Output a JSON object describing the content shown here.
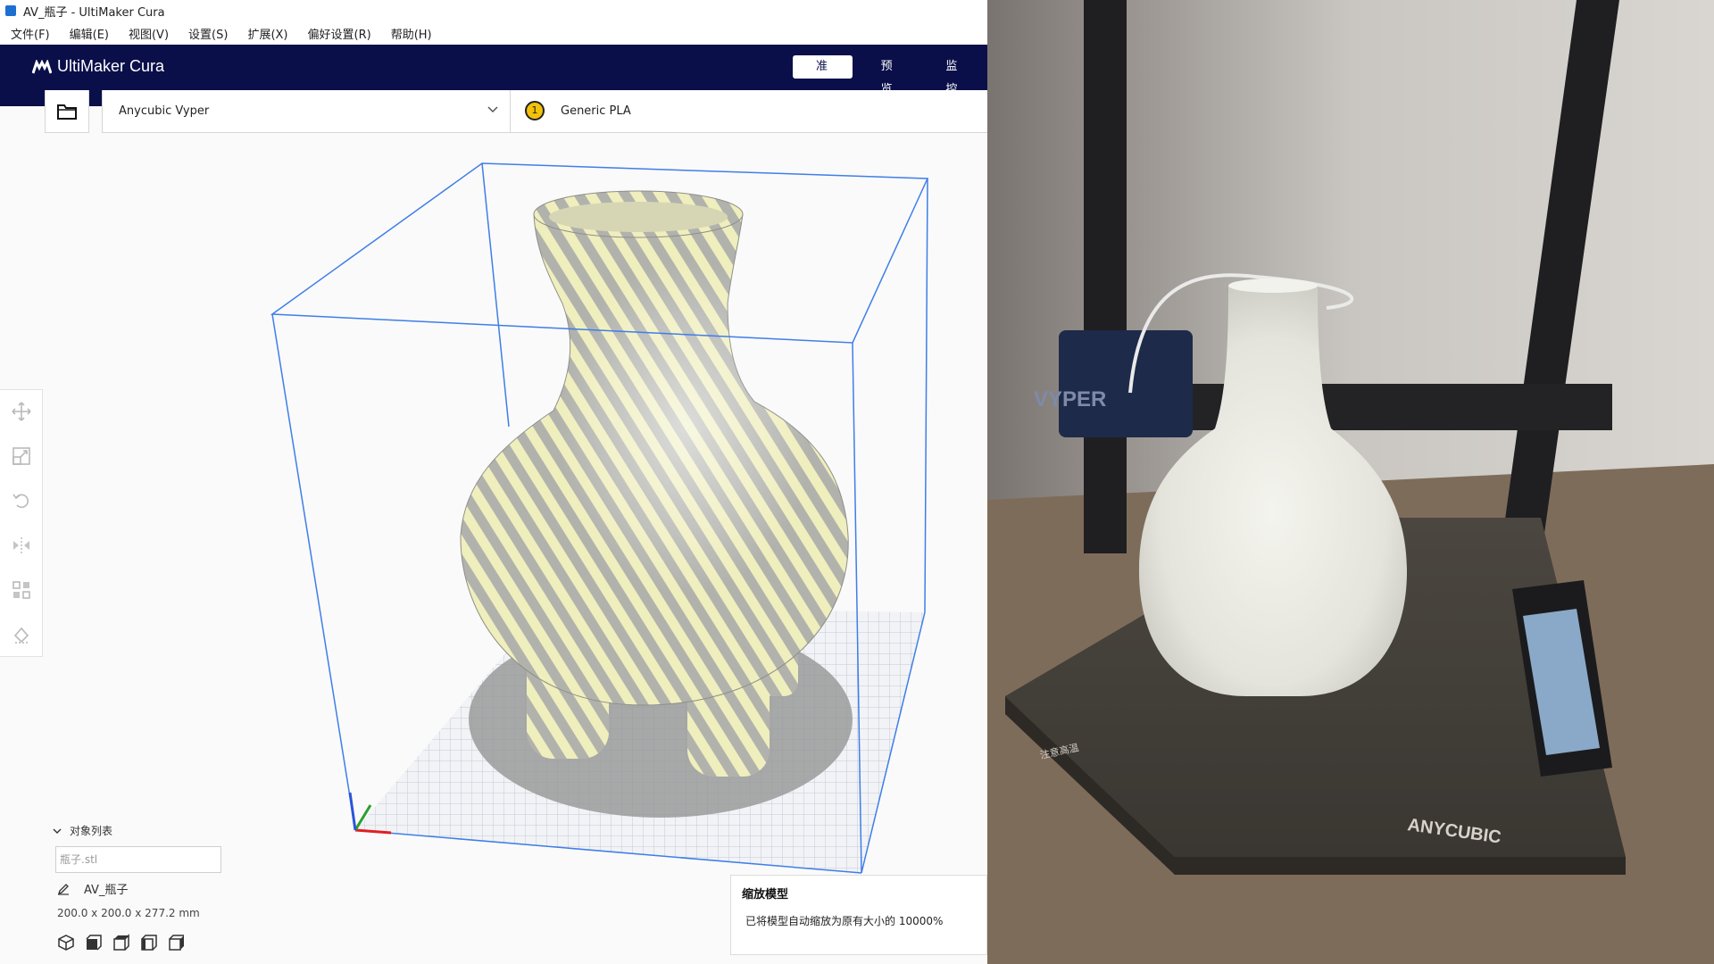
{
  "window": {
    "title": "AV_瓶子 - UltiMaker Cura"
  },
  "menu": [
    "文件(F)",
    "编辑(E)",
    "视图(V)",
    "设置(S)",
    "扩展(X)",
    "偏好设置(R)",
    "帮助(H)"
  ],
  "header": {
    "logo_text": "UltiMaker Cura",
    "stages": [
      {
        "label": "准备",
        "active": true
      },
      {
        "label": "预览",
        "active": false
      },
      {
        "label": "监控",
        "active": false
      }
    ]
  },
  "printer": {
    "name": "Anycubic Vyper"
  },
  "material": {
    "extruder_number": "1",
    "name": "Generic PLA",
    "color": "#f3c10a"
  },
  "tools": [
    "move-icon",
    "scale-icon",
    "rotate-icon",
    "mirror-icon",
    "per-model-settings-icon",
    "support-blocker-icon"
  ],
  "object_list": {
    "header": "对象列表",
    "item": "瓶子.stl"
  },
  "object": {
    "name": "AV_瓶子",
    "dimensions": "200.0 x 200.0 x 277.2 mm"
  },
  "view_icons": [
    "3d-view-icon",
    "front-view-icon",
    "top-view-icon",
    "left-view-icon",
    "right-view-icon"
  ],
  "toast": {
    "title": "缩放模型",
    "message": "已将模型自动缩放为原有大小的 10000%"
  },
  "photo": {
    "brand_text": "ANYCUBIC",
    "printer_label": "VYPER",
    "caution_label": "注意高温"
  },
  "colors": {
    "header_bg": "#0a0f4a",
    "build_volume": "#3f7ee8",
    "model_stripe": "#efeebd",
    "model_base": "#b2b2ad"
  }
}
